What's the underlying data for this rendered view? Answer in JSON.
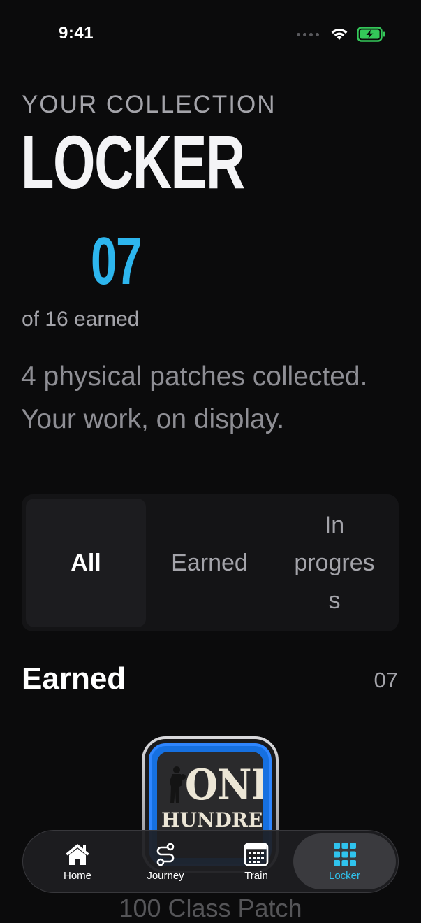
{
  "status_bar": {
    "time": "9:41"
  },
  "header": {
    "eyebrow": "YOUR COLLECTION",
    "title": "LOCKER"
  },
  "summary": {
    "count": "07",
    "count_caption": "of 16 earned",
    "description": "4 physical patches collected. Your work, on display."
  },
  "filter": {
    "options": [
      {
        "label": "All",
        "selected": true
      },
      {
        "label": "Earned",
        "selected": false
      },
      {
        "label": "In progres s",
        "selected": false
      }
    ]
  },
  "section": {
    "title": "Earned",
    "count": "07"
  },
  "patch": {
    "art_text_top": "ONE",
    "art_text_bottom": "HUNDRED",
    "label": "100 Class Patch"
  },
  "tab_bar": {
    "tabs": [
      {
        "label": "Home",
        "icon": "home-icon",
        "active": false
      },
      {
        "label": "Journey",
        "icon": "route-icon",
        "active": false
      },
      {
        "label": "Train",
        "icon": "calendar-icon",
        "active": false
      },
      {
        "label": "Locker",
        "icon": "grid-icon",
        "active": true
      }
    ]
  },
  "colors": {
    "background": "#0b0b0c",
    "accent": "#2db6ee",
    "active_tab": "#2fc3ee",
    "battery": "#34c759"
  }
}
